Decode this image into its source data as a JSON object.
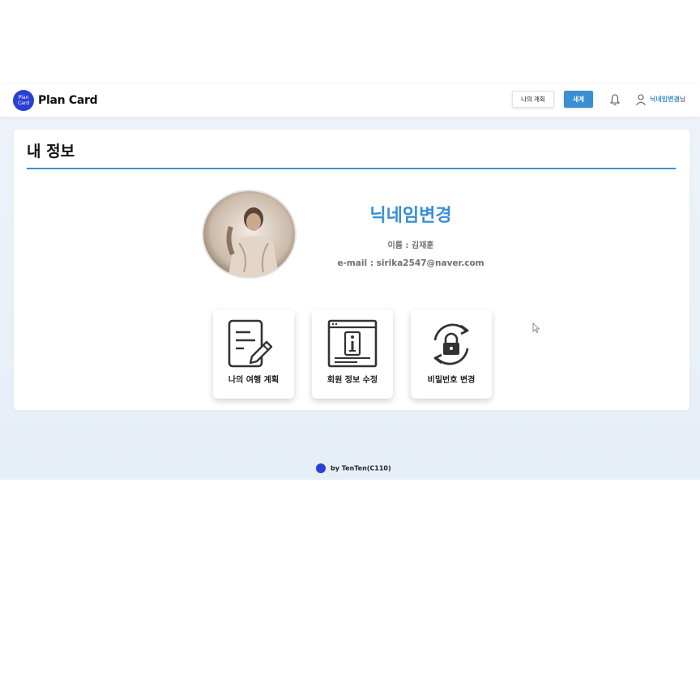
{
  "header": {
    "logo_text_line1": "Plan",
    "logo_text_line2": "Card",
    "brand": "Plan Card",
    "my_plan_button": "나의 계획",
    "new_button": "새계",
    "user_nickname": "닉네임변경",
    "user_suffix": "님"
  },
  "profile": {
    "page_title": "내 정보",
    "nickname": "닉네임변경",
    "name_line": "이름 : 김재훈",
    "email_line": "e-mail : sirika2547@naver.com"
  },
  "tiles": [
    {
      "label": "나의 여행 계획",
      "icon": "document-edit-icon"
    },
    {
      "label": "회원 정보 수정",
      "icon": "info-window-icon"
    },
    {
      "label": "비밀번호 변경",
      "icon": "lock-refresh-icon"
    }
  ],
  "footer": {
    "text": "by  TenTen(C110)"
  },
  "colors": {
    "accent": "#3a8fd4",
    "logo": "#2a3fd6",
    "background": "#eaf0f8"
  }
}
